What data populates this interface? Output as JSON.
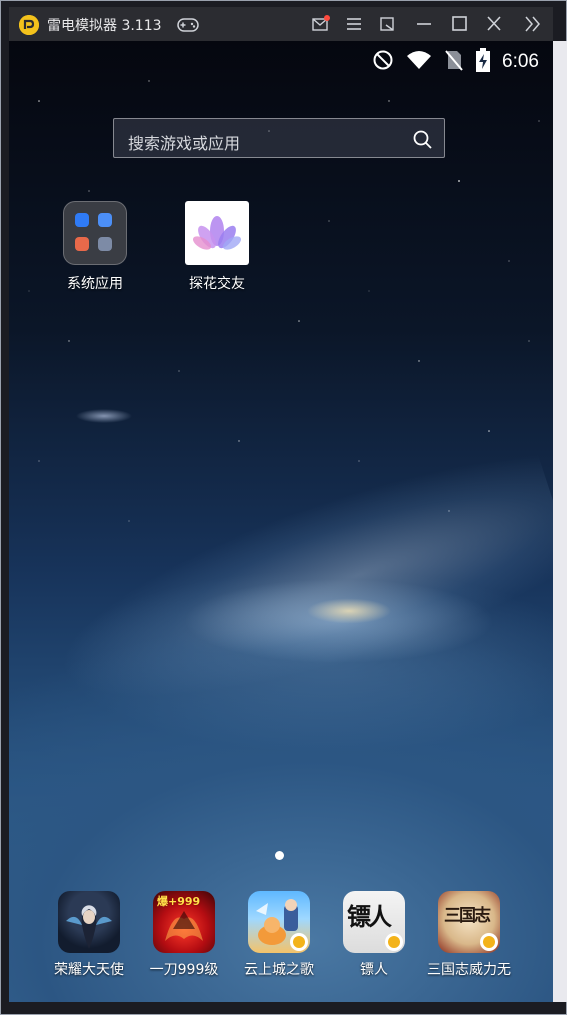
{
  "window": {
    "title": "雷电模拟器 3.113"
  },
  "status_bar": {
    "time": "6:06",
    "icons": [
      "do-not-disturb-icon",
      "wifi-icon",
      "no-sim-icon",
      "battery-charging-icon"
    ]
  },
  "search": {
    "placeholder": "搜索游戏或应用"
  },
  "desktop": {
    "apps": [
      {
        "label": "系统应用",
        "icon": "folder-icon"
      },
      {
        "label": "探花交友",
        "icon": "lotus-flower-icon"
      }
    ]
  },
  "dock": {
    "apps": [
      {
        "label": "荣耀大天使",
        "icon": "game-angel-icon"
      },
      {
        "label": "一刀999级",
        "icon": "game-red-dragon-icon",
        "badge_text": "爆+999"
      },
      {
        "label": "云上城之歌",
        "icon": "game-cloud-city-icon"
      },
      {
        "label": "镖人",
        "icon": "game-biaoren-icon",
        "glyph": "镖人"
      },
      {
        "label": "三国志威力无",
        "icon": "game-three-kingdoms-icon",
        "glyph": "三国志"
      }
    ]
  },
  "colors": {
    "titlebar": "#2b2c31",
    "logo": "#f3c21c",
    "notification_dot": "#ff4a3d"
  }
}
